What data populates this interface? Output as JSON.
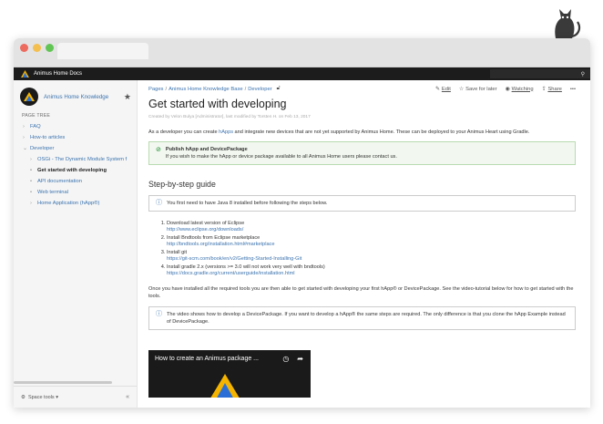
{
  "header": {
    "app_title": "Animus Home Docs",
    "search_icon": "search-icon"
  },
  "sidebar": {
    "space_name": "Animus Home Knowledge",
    "page_tree_label": "PAGE TREE",
    "items": [
      {
        "label": "FAQ",
        "level": 0,
        "active": false
      },
      {
        "label": "How-to articles",
        "level": 0,
        "active": false
      },
      {
        "label": "Developer",
        "level": 0,
        "active": false,
        "expanded": true
      },
      {
        "label": "OSGi - The Dynamic Module System f",
        "level": 1,
        "active": false
      },
      {
        "label": "Get started with developing",
        "level": 1,
        "active": true
      },
      {
        "label": "API documentation",
        "level": 1,
        "active": false
      },
      {
        "label": "Web terminal",
        "level": 1,
        "active": false
      },
      {
        "label": "Home Application (hApp®)",
        "level": 1,
        "active": false
      }
    ],
    "space_tools_label": "Space tools ▾",
    "collapse_label": "«"
  },
  "breadcrumb": {
    "pages": "Pages",
    "base": "Animus Home Knowledge Base",
    "developer": "Developer"
  },
  "actions": {
    "edit": "Edit",
    "save_later": "Save for later",
    "watching": "Watching",
    "share": "Share",
    "more": "•••"
  },
  "page": {
    "title": "Get started with developing",
    "byline": "Created by Velon Bulya [Administrator], last modified by Torsten H. on Feb 13, 2017",
    "intro_before": "As a developer you can create ",
    "intro_link": "hApps",
    "intro_after": " and integrate new devices that are not yet supported by Animus Home. These can be deployed to your Animus Heart using Gradle.",
    "success_title": "Publish hApp and DevicePackage",
    "success_text": "If you wish to make the hApp or device package available to all Animus Home users please contact us.",
    "step_heading": "Step-by-step guide",
    "java_note": "You first need to have Java 8 installed before following the steps below.",
    "steps": [
      {
        "text": "Download latest version of Eclipse",
        "url": "http://www.eclipse.org/downloads/"
      },
      {
        "text": "Install Bndtools from Eclipse marketplace",
        "url": "http://bndtools.org/installation.html#marketplace"
      },
      {
        "text": "Install git",
        "url": "https://git-scm.com/book/en/v2/Getting-Started-Installing-Git"
      },
      {
        "text": "Install gradle 2.x (versions >= 3.0 will not work very well with bndtools)",
        "url": "https://docs.gradle.org/current/userguide/installation.html"
      }
    ],
    "after_text": "Once you have installed all the required tools you are then able to get started with developing your first hApp® or DevicePackage. See the video-tutorial below for how to get started with the tools.",
    "video_note": "The video shows how to develop a DevicePackage. If you want to develop a hApp® the same steps are required. The only difference is that you clone the hApp Example instead of DevicePackage.",
    "video_title": "How to create an Animus package ..."
  },
  "colors": {
    "link": "#3b73af",
    "topbar": "#1c1c1c",
    "success_border": "#b9dbb1",
    "logo_yellow": "#f5b400",
    "logo_blue": "#2b6fd6"
  }
}
